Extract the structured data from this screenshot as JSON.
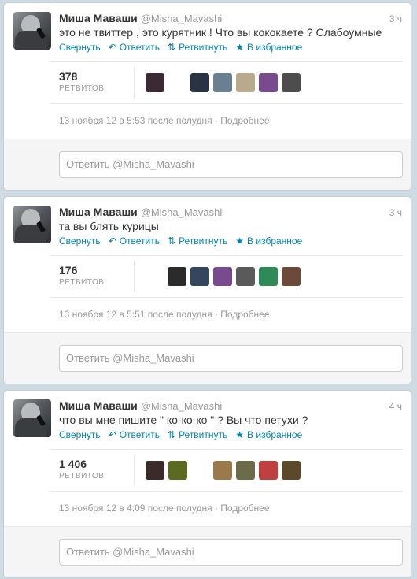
{
  "tweets": [
    {
      "fullname": "Миша Маваши",
      "screenname": "@Misha_Mavashi",
      "time": "3 ч",
      "text": "это не твиттер , это курятник ! Что вы кококаете ? Слабоумные",
      "actions": {
        "collapse": "Свернуть",
        "reply": "Ответить",
        "retweet": "Ретвитнуть",
        "favorite": "В избранное"
      },
      "retweet_count": "378",
      "retweet_label": "РЕТВИТОВ",
      "timestamp": "13 ноября 12 в 5:53 после полудня",
      "details": "Подробнее",
      "reply_placeholder": "Ответить @Misha_Mavashi",
      "retweeters": [
        "#3b2a33",
        "#2a3344",
        "#6b7f93",
        "#b9a98d",
        "#7a4a8f",
        "#4d4d4d"
      ]
    },
    {
      "fullname": "Миша Маваши",
      "screenname": "@Misha_Mavashi",
      "time": "3 ч",
      "text": "та вы блять курицы",
      "actions": {
        "collapse": "Свернуть",
        "reply": "Ответить",
        "retweet": "Ретвитнуть",
        "favorite": "В избранное"
      },
      "retweet_count": "176",
      "retweet_label": "РЕТВИТОВ",
      "timestamp": "13 ноября 12 в 5:51 после полудня",
      "details": "Подробнее",
      "reply_placeholder": "Ответить @Misha_Mavashi",
      "retweeters": [
        "#2b2b2b",
        "#34465c",
        "#7a4a8f",
        "#5a5a5a",
        "#2e8b57",
        "#6b4a3a"
      ]
    },
    {
      "fullname": "Миша Маваши",
      "screenname": "@Misha_Mavashi",
      "time": "4 ч",
      "text": "что вы мне пишите \" ко-ко-ко \" ? Вы что петухи ?",
      "actions": {
        "collapse": "Свернуть",
        "reply": "Ответить",
        "retweet": "Ретвитнуть",
        "favorite": "В избранное"
      },
      "retweet_count": "1 406",
      "retweet_label": "РЕТВИТОВ",
      "timestamp": "13 ноября 12 в 4:09 после полудня",
      "details": "Подробнее",
      "reply_placeholder": "Ответить @Misha_Mavashi",
      "retweeters": [
        "#3a2a2a",
        "#5a6a1f",
        "#9a7a4a",
        "#6b6b4a",
        "#c04040",
        "#5a4a2a"
      ]
    }
  ],
  "icons": {
    "reply": "reply-arrow-icon",
    "retweet": "retweet-icon",
    "favorite": "star-icon"
  }
}
